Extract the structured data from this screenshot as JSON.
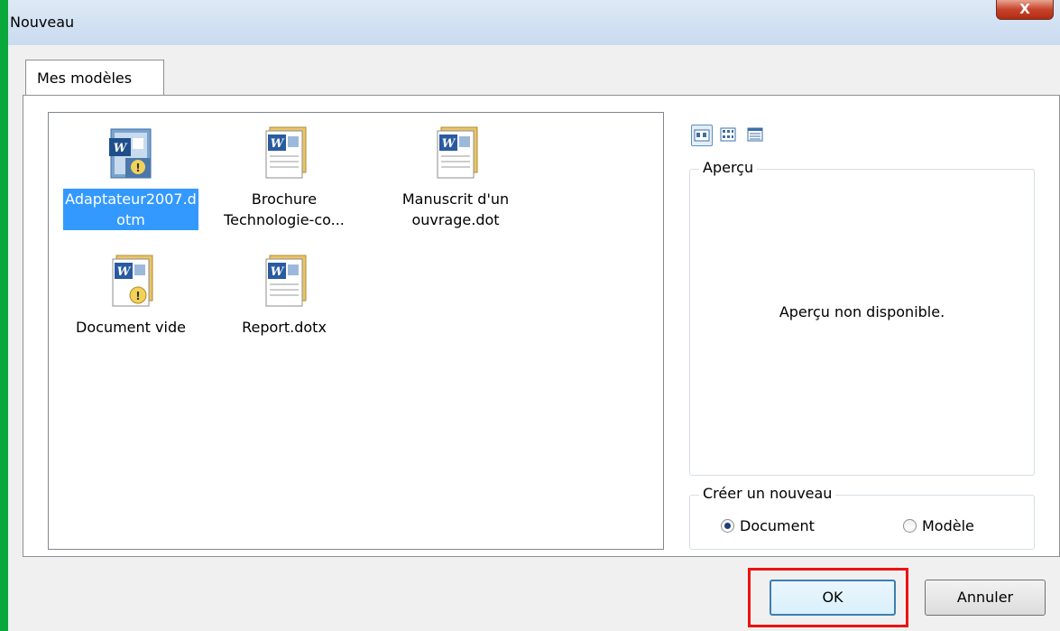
{
  "dialog": {
    "title": "Nouveau",
    "close_label": "X"
  },
  "tabs": [
    {
      "label": "Mes modèles"
    }
  ],
  "templates": [
    {
      "label": "Adaptateur2007.dotm",
      "icon": "word-macro-template-icon",
      "selected": true
    },
    {
      "label": "Brochure Technologie-co...",
      "icon": "word-template-icon",
      "selected": false
    },
    {
      "label": "Manuscrit d'un ouvrage.dot",
      "icon": "word-template-icon",
      "selected": false
    },
    {
      "label": "Document vide",
      "icon": "word-macro-template-icon",
      "selected": false
    },
    {
      "label": "Report.dotx",
      "icon": "word-template-icon",
      "selected": false
    }
  ],
  "view_buttons": [
    {
      "icon": "large-icons-view-icon",
      "active": true
    },
    {
      "icon": "list-view-icon",
      "active": false
    },
    {
      "icon": "details-view-icon",
      "active": false
    }
  ],
  "preview": {
    "legend": "Aperçu",
    "message": "Aperçu non disponible."
  },
  "create_new": {
    "legend": "Créer un nouveau",
    "options": [
      {
        "label": "Document",
        "checked": true
      },
      {
        "label": "Modèle",
        "checked": false
      }
    ]
  },
  "buttons": {
    "ok": "OK",
    "cancel": "Annuler"
  },
  "colors": {
    "selection": "#3399ff",
    "highlight": "#ee1111",
    "frame": "#0aa73a"
  }
}
